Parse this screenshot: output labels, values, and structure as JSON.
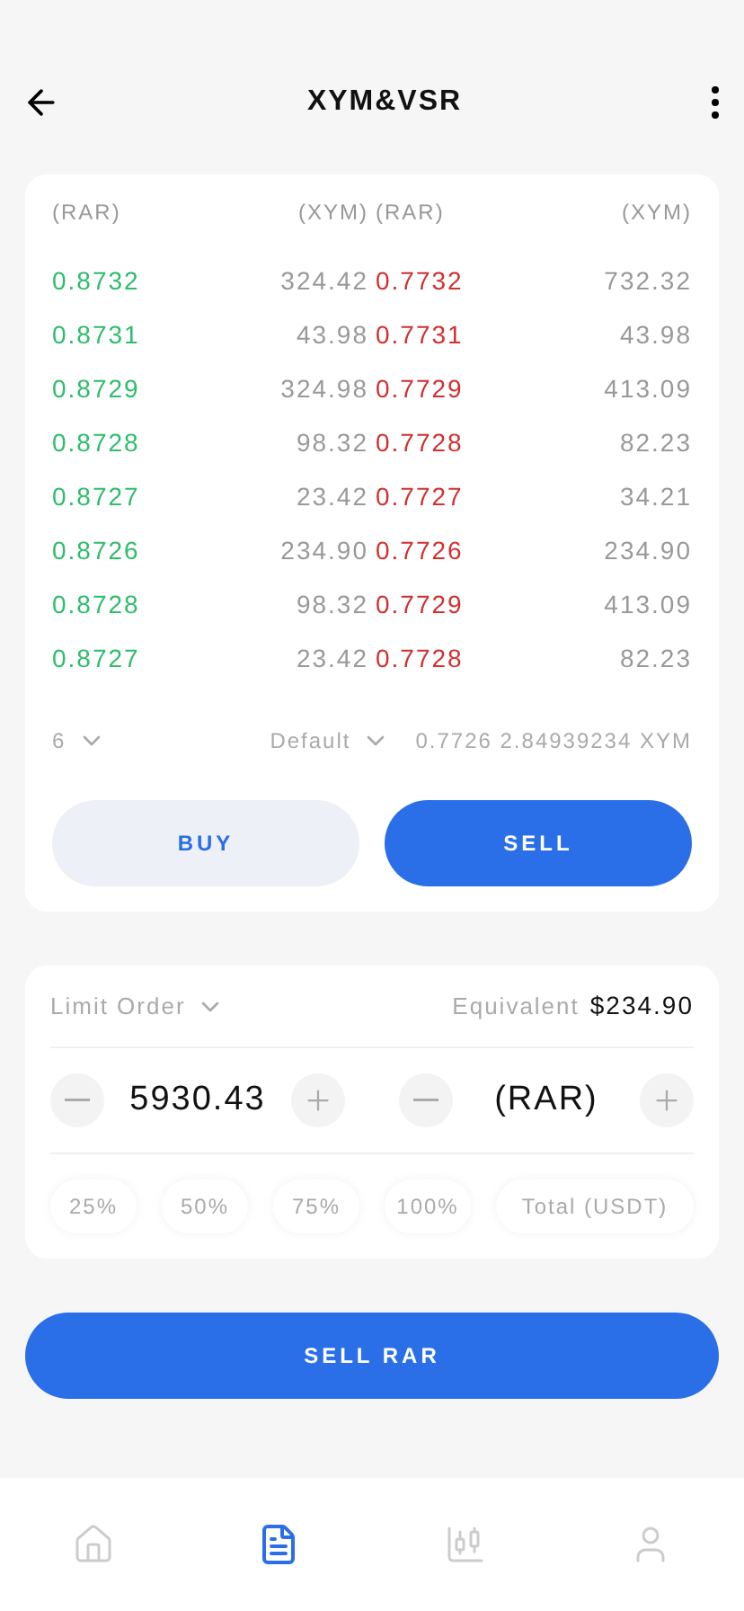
{
  "header": {
    "title": "XYM&VSR"
  },
  "order_book": {
    "columns": [
      "(RAR)",
      "(XYM)",
      "(RAR)",
      "(XYM)"
    ],
    "rows": [
      {
        "bid_price": "0.8732",
        "bid_amount": "324.42",
        "ask_price": "0.7732",
        "ask_amount": "732.32"
      },
      {
        "bid_price": "0.8731",
        "bid_amount": "43.98",
        "ask_price": "0.7731",
        "ask_amount": "43.98"
      },
      {
        "bid_price": "0.8729",
        "bid_amount": "324.98",
        "ask_price": "0.7729",
        "ask_amount": "413.09"
      },
      {
        "bid_price": "0.8728",
        "bid_amount": "98.32",
        "ask_price": "0.7728",
        "ask_amount": "82.23"
      },
      {
        "bid_price": "0.8727",
        "bid_amount": "23.42",
        "ask_price": "0.7727",
        "ask_amount": "34.21"
      },
      {
        "bid_price": "0.8726",
        "bid_amount": "234.90",
        "ask_price": "0.7726",
        "ask_amount": "234.90"
      },
      {
        "bid_price": "0.8728",
        "bid_amount": "98.32",
        "ask_price": "0.7729",
        "ask_amount": "413.09"
      },
      {
        "bid_price": "0.8727",
        "bid_amount": "23.42",
        "ask_price": "0.7728",
        "ask_amount": "82.23"
      }
    ],
    "depth": "6",
    "mode": "Default",
    "last_trade": "0.7726 2.84939234 XYM"
  },
  "sides": [
    {
      "label": "BUY",
      "selected": false
    },
    {
      "label": "SELL",
      "selected": true
    }
  ],
  "order": {
    "type": "Limit Order",
    "equivalent_label": "Equivalent",
    "equivalent_value": "$234.90",
    "amount": "5930.43",
    "unit": "(RAR)",
    "presets": [
      "25%",
      "50%",
      "75%",
      "100%",
      "Total (USDT)"
    ]
  },
  "submit": "SELL RAR",
  "nav": [
    {
      "kind": "home",
      "selected": false
    },
    {
      "kind": "orders",
      "selected": true
    },
    {
      "kind": "chart",
      "selected": false
    },
    {
      "kind": "profile",
      "selected": false
    }
  ]
}
